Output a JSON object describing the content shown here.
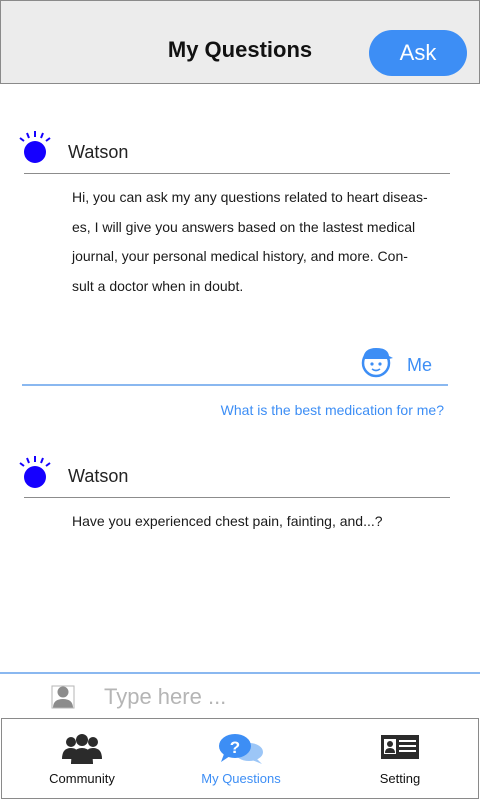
{
  "header": {
    "title": "My Questions",
    "ask_label": "Ask"
  },
  "messages": [
    {
      "sender": "Watson",
      "icon": "watson-icon",
      "lines": [
        "Hi, you can ask my any questions related to heart diseas-",
        "es, I will give you answers based on the lastest medical",
        "journal, your personal medical history, and more. Con-",
        "sult a doctor when in doubt."
      ]
    },
    {
      "sender": "Me",
      "icon": "user-avatar-icon",
      "text": "What is the best medication for me?"
    },
    {
      "sender": "Watson",
      "icon": "watson-icon",
      "lines": [
        "Have you experienced chest pain, fainting, and...?"
      ]
    }
  ],
  "input": {
    "placeholder": "Type here ...",
    "value": ""
  },
  "tabs": [
    {
      "label": "Community",
      "icon": "community-icon",
      "active": false
    },
    {
      "label": "My Questions",
      "icon": "questions-icon",
      "active": true
    },
    {
      "label": "Setting",
      "icon": "id-card-icon",
      "active": false
    }
  ],
  "colors": {
    "accent": "#3d8ef5",
    "watson": "#1500ff",
    "header_bg": "#ececec",
    "divider": "#8c8c8c"
  }
}
